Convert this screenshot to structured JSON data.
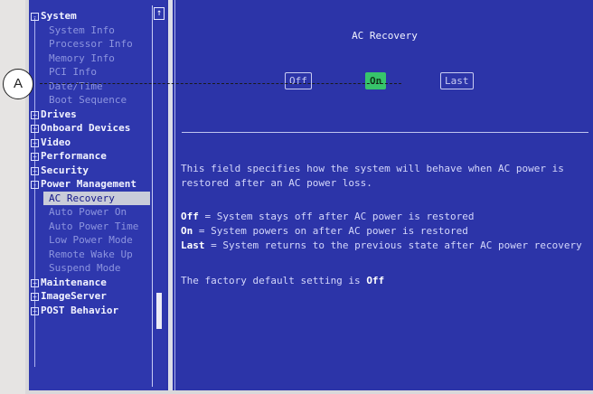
{
  "callout": {
    "label": "A"
  },
  "sidebar": {
    "groups": [
      {
        "label": "System",
        "expander": "-",
        "items": [
          "System Info",
          "Processor Info",
          "Memory Info",
          "PCI Info",
          "Date/Time",
          "Boot Sequence"
        ]
      },
      {
        "label": "Drives",
        "expander": "+"
      },
      {
        "label": "Onboard Devices",
        "expander": "+"
      },
      {
        "label": "Video",
        "expander": "+"
      },
      {
        "label": "Performance",
        "expander": "+"
      },
      {
        "label": "Security",
        "expander": "+"
      },
      {
        "label": "Power Management",
        "expander": "-",
        "items": [
          "AC Recovery",
          "Auto Power On",
          "Auto Power Time",
          "Low Power Mode",
          "Remote Wake Up",
          "Suspend Mode"
        ],
        "selected": "AC Recovery"
      },
      {
        "label": "Maintenance",
        "expander": "+"
      },
      {
        "label": "ImageServer",
        "expander": "+"
      },
      {
        "label": "POST Behavior",
        "expander": "+"
      }
    ],
    "scroll_up_glyph": "↑"
  },
  "detail": {
    "title": "AC Recovery",
    "options": [
      {
        "label": "Off",
        "selected": false
      },
      {
        "label": "On",
        "selected": true
      },
      {
        "label": "Last",
        "selected": false
      }
    ],
    "description_line1": "This field specifies how the system will behave when AC power is",
    "description_line2": "restored after an AC power loss.",
    "legend": [
      {
        "key": "Off",
        "text": " = System stays off after AC power is restored"
      },
      {
        "key": "On",
        "text": "  = System powers on after AC power is restored"
      },
      {
        "key": "Last",
        "text": " = System returns to the previous state after AC power recovery"
      }
    ],
    "default_prefix": "The factory default setting is ",
    "default_value": "Off"
  },
  "colors": {
    "screen_bg": "#2c34a8",
    "selected_option": "#37c46b",
    "selected_item_bg": "#c9ccd9"
  }
}
